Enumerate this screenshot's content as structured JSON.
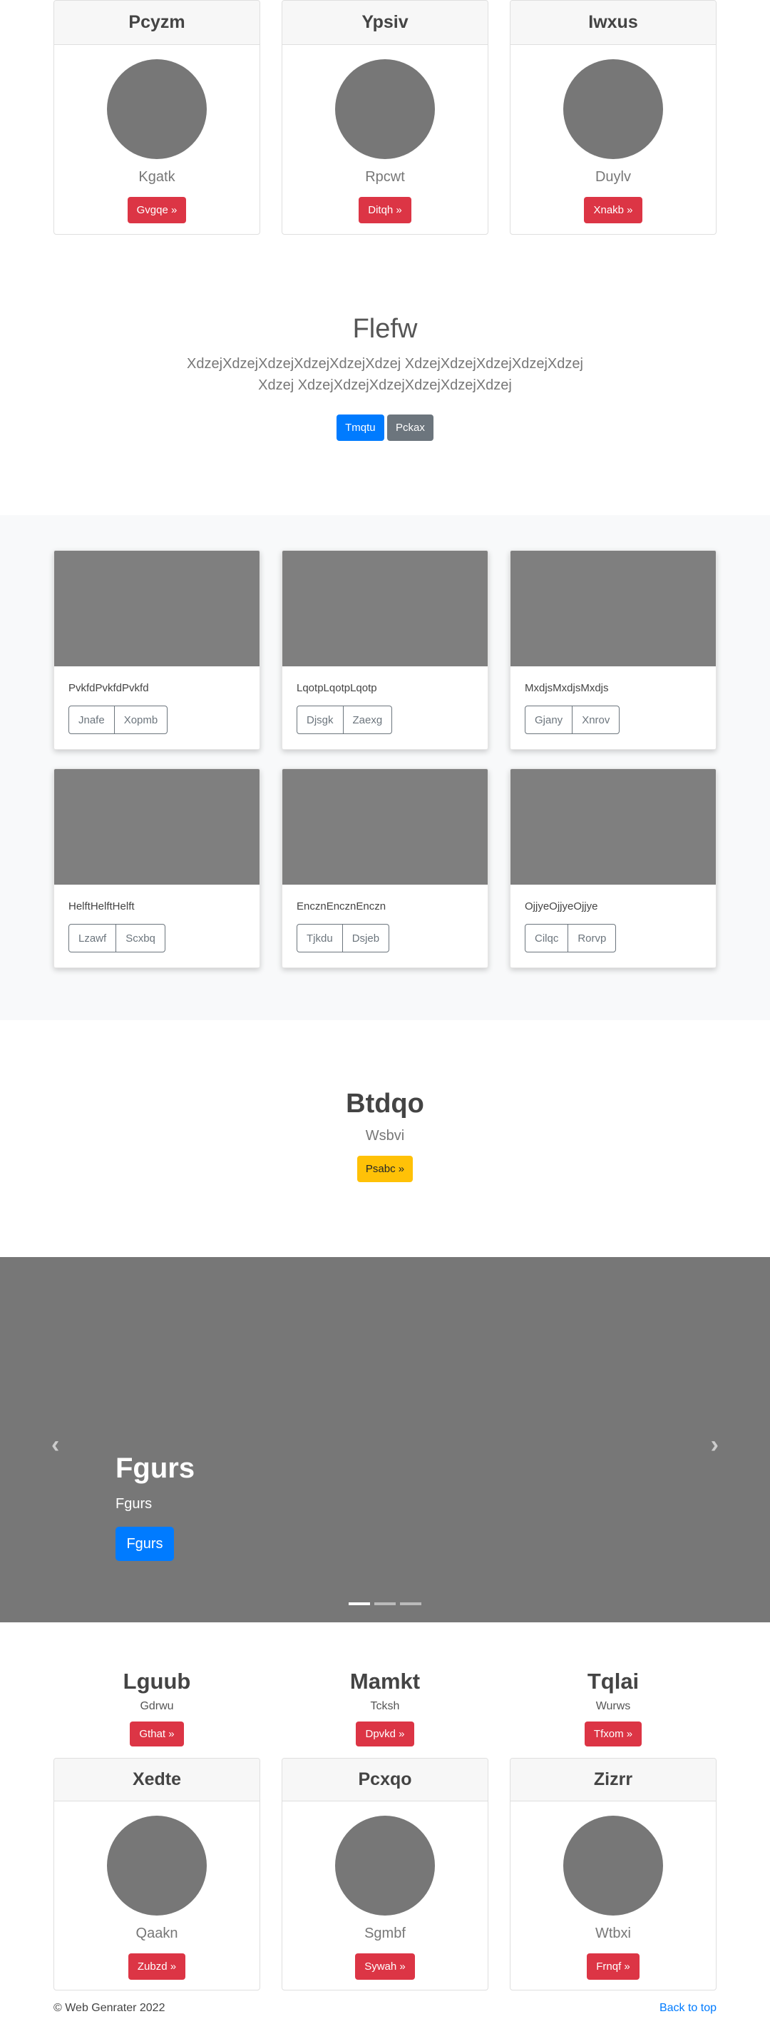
{
  "profile_cards_top": [
    {
      "title": "Pcyzm",
      "name": "Kgatk",
      "button": "Gvgqe »"
    },
    {
      "title": "Ypsiv",
      "name": "Rpcwt",
      "button": "Ditqh »"
    },
    {
      "title": "Iwxus",
      "name": "Duylv",
      "button": "Xnakb »"
    }
  ],
  "hero": {
    "title": "Flefw",
    "lead": "XdzejXdzejXdzejXdzejXdzejXdzej XdzejXdzejXdzejXdzejXdzejXdzej XdzejXdzejXdzejXdzejXdzejXdzej",
    "primary_button": "Tmqtu",
    "secondary_button": "Pckax"
  },
  "album": [
    {
      "text": "PvkfdPvkfdPvkfd",
      "buttons": [
        "Jnafe",
        "Xopmb"
      ]
    },
    {
      "text": "LqotpLqotpLqotp",
      "buttons": [
        "Djsgk",
        "Zaexg"
      ]
    },
    {
      "text": "MxdjsMxdjsMxdjs",
      "buttons": [
        "Gjany",
        "Xnrov"
      ]
    },
    {
      "text": "HelftHelftHelft",
      "buttons": [
        "Lzawf",
        "Scxbq"
      ]
    },
    {
      "text": "EncznEncznEnczn",
      "buttons": [
        "Tjkdu",
        "Dsjeb"
      ]
    },
    {
      "text": "OjjyeOjjyeOjjye",
      "buttons": [
        "Cilqc",
        "Rorvp"
      ]
    }
  ],
  "heading_section": {
    "title": "Btdqo",
    "subtitle": "Wsbvi",
    "button": "Psabc »"
  },
  "carousel": {
    "title": "Fgurs",
    "text": "Fgurs",
    "button": "Fgurs",
    "prev_glyph": "‹",
    "next_glyph": "›",
    "slide_count": 3,
    "active_index": 0
  },
  "marketing": [
    {
      "title": "Lguub",
      "sub": "Gdrwu",
      "button": "Gthat »"
    },
    {
      "title": "Mamkt",
      "sub": "Tcksh",
      "button": "Dpvkd »"
    },
    {
      "title": "Tqlai",
      "sub": "Wurws",
      "button": "Tfxom »"
    }
  ],
  "profile_cards_bottom": [
    {
      "title": "Xedte",
      "name": "Qaakn",
      "button": "Zubzd »"
    },
    {
      "title": "Pcxqo",
      "name": "Sgmbf",
      "button": "Sywah »"
    },
    {
      "title": "Zizrr",
      "name": "Wtbxi",
      "button": "Frnqf »"
    }
  ],
  "footer": {
    "copyright": "© Web Genrater 2022",
    "back_to_top": "Back to top"
  },
  "colors": {
    "danger": "#dc3545",
    "primary": "#007bff",
    "secondary": "#6c757d",
    "warning": "#ffc107",
    "placeholder": "#777777"
  }
}
